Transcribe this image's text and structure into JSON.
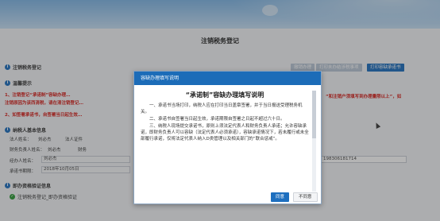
{
  "page": {
    "title": "注销税务登记"
  },
  "toolbar": {
    "section": "注销税务登记",
    "btn_reset": "撤销办理",
    "btn_print_unused": "打印未办结涉税事项",
    "btn_print_promise": "打印容缺承诺书"
  },
  "notice": {
    "title": "温馨提示",
    "line1a": "1、注销登记“承诺制”容缺办理…",
    "line1b": "注销原因为该西清税，请在清注销登记…",
    "line1_right": "”和注销户须填写到办理量限以上”，如",
    "line2": "2、如签署承诺书，自签署当日起生效…"
  },
  "taxpayer": {
    "section": "纳税人基本信息",
    "legal_rep_label": "法人姓名：",
    "legal_rep_value": "刘必杰",
    "legal_id_label": "法人证件",
    "fin_label": "财务负责人姓名：",
    "fin_value": "刘必杰",
    "fin_id_label": "财务",
    "agent_label": "经办人姓名：",
    "agent_value": "刘必杰",
    "phone_value": "198306181714",
    "promise_date_label": "承诺书期限：",
    "promise_date_value": "2018年10月05日"
  },
  "qualify": {
    "section": "即办资格验证信息",
    "line": "注销税务登记_即办资格验证"
  },
  "modal": {
    "header": "容缺办理填写说明",
    "title": "“承诺制”容缺办理填写说明",
    "p1": "一、承诺书当场打印，纳税人应在打印当日盖章签署，并于当日报送受理税务机关。",
    "p2": "二、承诺书自签署当日起生效，承诺期限自签署之日起不超过六十日。",
    "p3": "三、纳税人现场提交承诺书，原则上须法定代表人和财务负责人承诺；允许容缺承诺，即财务负责人可以容缺（法定代表人必须承诺），容缺承诺情况下，若未履行或未全部履行承诺，仅将法定代表人纳入D类管理以及相关部门的“联合惩戒”。",
    "btn_agree": "同意",
    "btn_disagree": "不同意"
  }
}
